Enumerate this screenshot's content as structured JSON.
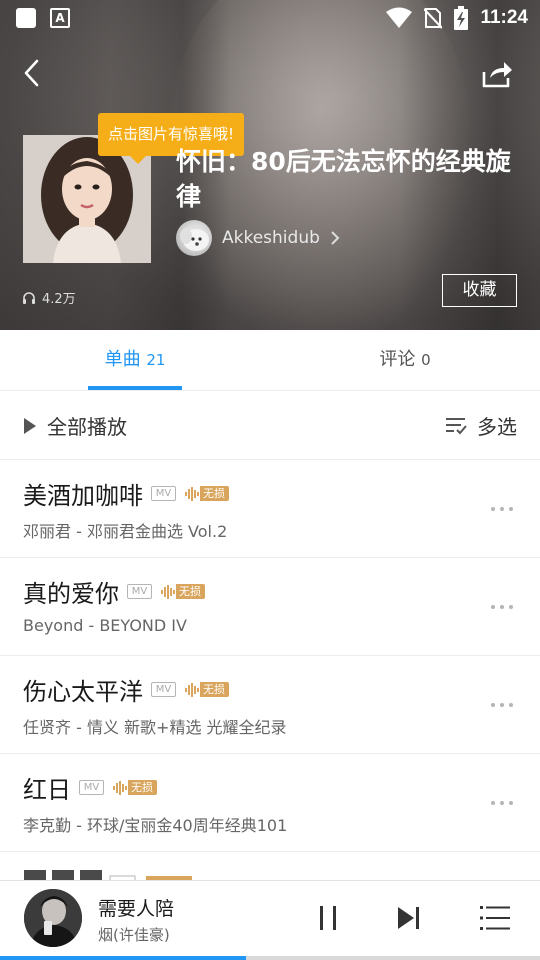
{
  "status_bar": {
    "time": "11:24"
  },
  "header": {
    "tooltip": "点击图片有惊喜哦!",
    "playlist_title": "怀旧：80后无法忘怀的经典旋律",
    "author_name": "Akkeshidub",
    "listen_count": "4.2万",
    "collect_label": "收藏"
  },
  "tabs": [
    {
      "label": "单曲",
      "count": "21",
      "active": true
    },
    {
      "label": "评论",
      "count": "0",
      "active": false
    }
  ],
  "actions": {
    "play_all": "全部播放",
    "multi_select": "多选"
  },
  "songs": [
    {
      "title": "美酒加咖啡",
      "mv": "MV",
      "lossless": "无损",
      "artist": "邓丽君",
      "album": "邓丽君金曲选 Vol.2"
    },
    {
      "title": "真的爱你",
      "mv": "MV",
      "lossless": "无损",
      "artist": "Beyond",
      "album": "BEYOND IV"
    },
    {
      "title": "伤心太平洋",
      "mv": "MV",
      "lossless": "无损",
      "artist": "任贤齐",
      "album": "情义 新歌+精选 光耀全纪录"
    },
    {
      "title": "红日",
      "mv": "MV",
      "lossless": "无损",
      "artist": "李克勤",
      "album": "环球/宝丽金40周年经典101"
    },
    {
      "title": "",
      "mv": "",
      "lossless": "",
      "artist": "",
      "album": ""
    }
  ],
  "player": {
    "title": "需要人陪",
    "artist": "烟(许佳豪)",
    "progress": 0.455
  },
  "colors": {
    "accent": "#2196f3",
    "tooltip": "#f5ae18",
    "lossless_badge": "#d9a45b"
  },
  "icons": {
    "back": "back-arrow-icon",
    "share": "share-icon",
    "headphones": "headphones-icon",
    "play": "play-triangle-icon",
    "multi_select": "multi-select-list-icon",
    "more": "more-dots-icon",
    "pause": "pause-icon",
    "next": "next-track-icon",
    "queue": "playlist-queue-icon"
  }
}
